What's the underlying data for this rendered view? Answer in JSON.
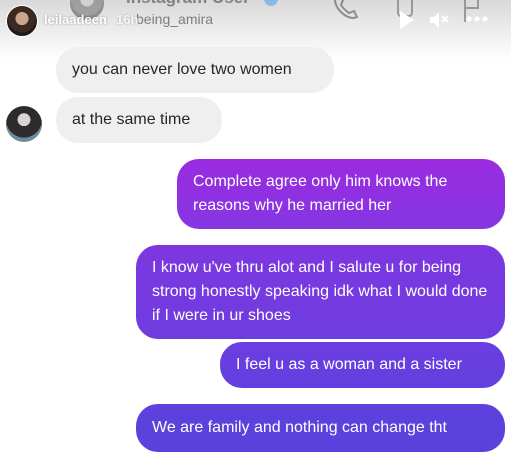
{
  "story": {
    "username": "leilaadeen",
    "time": "16h"
  },
  "chat_header": {
    "title": "Instagram User",
    "handle": "being_amira"
  },
  "icons": {
    "phone": "phone-icon",
    "video": "video-icon",
    "mute": "mute-icon",
    "flag": "flag-icon",
    "more": "more-icon"
  },
  "messages": [
    {
      "side": "incoming",
      "text": "you can never love two women"
    },
    {
      "side": "incoming",
      "text": "at the same time"
    },
    {
      "side": "outgoing",
      "text": "Complete agree  only him knows the reasons  why he married her"
    },
    {
      "side": "outgoing",
      "text": "I know u've thru alot and I salute u for being strong honestly speaking idk what I would done if I were in ur shoes"
    },
    {
      "side": "outgoing",
      "text": "I feel u as a woman and a sister"
    },
    {
      "side": "outgoing",
      "text": "We are family and nothing can change  tht"
    }
  ],
  "colors": {
    "incoming_bubble": "#efefef",
    "outgoing_gradient_top": "#8a2be2",
    "outgoing_gradient_bottom": "#5b3fd6"
  }
}
